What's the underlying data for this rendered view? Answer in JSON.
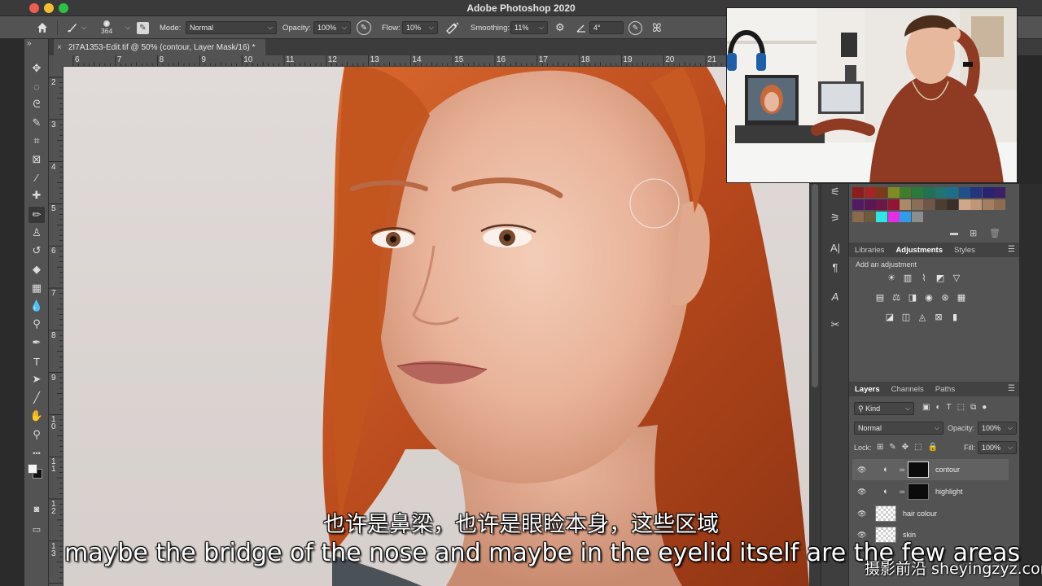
{
  "window": {
    "app_title": "Adobe Photoshop 2020"
  },
  "options_bar": {
    "brush_size": "364",
    "mode_label": "Mode:",
    "mode_value": "Normal",
    "opacity_label": "Opacity:",
    "opacity_value": "100%",
    "flow_label": "Flow:",
    "flow_value": "10%",
    "smoothing_label": "Smoothing:",
    "smoothing_value": "11%",
    "angle_value": "4°",
    "collapse_glyph": "»"
  },
  "document": {
    "tab_title": "2I7A1353-Edit.tif @ 50% (contour, Layer Mask/16) *",
    "close_glyph": "×"
  },
  "rulers": {
    "top": [
      "6",
      "7",
      "8",
      "9",
      "10",
      "11",
      "12",
      "13",
      "14",
      "15",
      "16",
      "17",
      "18",
      "19",
      "20",
      "21"
    ],
    "left": [
      "2",
      "3",
      "4",
      "5",
      "6",
      "7",
      "8",
      "9",
      "1\n0",
      "1\n1",
      "1\n2",
      "1\n3"
    ]
  },
  "tools": [
    {
      "name": "move-tool",
      "glyph": "✥"
    },
    {
      "name": "marquee-tool",
      "glyph": "◌"
    },
    {
      "name": "lasso-tool",
      "glyph": "ᘓ"
    },
    {
      "name": "quick-select-tool",
      "glyph": "✎"
    },
    {
      "name": "crop-tool",
      "glyph": "⌗"
    },
    {
      "name": "frame-tool",
      "glyph": "⊠"
    },
    {
      "name": "eyedropper-tool",
      "glyph": "⁄"
    },
    {
      "name": "healing-brush-tool",
      "glyph": "✚"
    },
    {
      "name": "brush-tool",
      "glyph": "✏"
    },
    {
      "name": "clone-stamp-tool",
      "glyph": "♙"
    },
    {
      "name": "history-brush-tool",
      "glyph": "↺"
    },
    {
      "name": "eraser-tool",
      "glyph": "◆"
    },
    {
      "name": "gradient-tool",
      "glyph": "▦"
    },
    {
      "name": "blur-tool",
      "glyph": "💧"
    },
    {
      "name": "dodge-tool",
      "glyph": "⚲"
    },
    {
      "name": "pen-tool",
      "glyph": "✒"
    },
    {
      "name": "type-tool",
      "glyph": "T"
    },
    {
      "name": "path-select-tool",
      "glyph": "➤"
    },
    {
      "name": "line-tool",
      "glyph": "╱"
    },
    {
      "name": "hand-tool",
      "glyph": "✋"
    },
    {
      "name": "zoom-tool",
      "glyph": "⚲"
    },
    {
      "name": "more-tools",
      "glyph": "•••"
    }
  ],
  "adjustments_panel": {
    "tabs": [
      "Libraries",
      "Adjustments",
      "Styles"
    ],
    "active_tab": "Adjustments",
    "hint": "Add an adjustment"
  },
  "layers_panel": {
    "tabs": [
      "Layers",
      "Channels",
      "Paths"
    ],
    "active_tab": "Layers",
    "filter_label": "Kind",
    "blend_mode": "Normal",
    "opacity_label": "Opacity:",
    "opacity_value": "100%",
    "lock_label": "Lock:",
    "fill_label": "Fill:",
    "fill_value": "100%",
    "layers": [
      {
        "name": "contour",
        "selected": true,
        "type": "curves"
      },
      {
        "name": "highlight",
        "selected": false,
        "type": "curves"
      },
      {
        "name": "hair colour",
        "selected": false,
        "type": "pixel"
      },
      {
        "name": "skin",
        "selected": false,
        "type": "pixel"
      }
    ]
  },
  "swatch_colors": [
    "#8b1d1d",
    "#a52525",
    "#7c3a1b",
    "#7f8b22",
    "#3f7d2a",
    "#2c7a39",
    "#1f7350",
    "#1f7670",
    "#1c6f8a",
    "#214f8a",
    "#24347d",
    "#2a2372",
    "#3b2068",
    "#521a63",
    "#5b1753",
    "#6d1746",
    "#911633",
    "#a88a6b",
    "#8a6f58",
    "#6f5646",
    "#4b3d32",
    "#3a302a",
    "#cfa78a",
    "#c09676",
    "#a27e63",
    "#8e6c52",
    "#8a6a4a",
    "#6d5a3f",
    "#2ee6e6",
    "#e62ee6",
    "#2e9fe6",
    "#8d8d8d"
  ],
  "subtitles": {
    "zh": "也许是鼻梁，也许是眼睑本身，这些区域",
    "en": "maybe the bridge of the nose and maybe in the eyelid itself are the few areas"
  },
  "watermark": "摄影前沿 sheyingzyz.com"
}
